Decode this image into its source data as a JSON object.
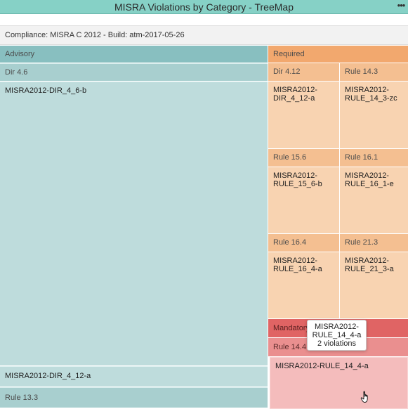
{
  "window": {
    "title": "MISRA Violations by Category - TreeMap",
    "menu_icon": "ellipsis-icon"
  },
  "subtitle": "Compliance: MISRA C 2012 - Build: atm-2017-05-26",
  "treemap": {
    "advisory": {
      "label": "Advisory",
      "dir_4_6": {
        "label": "Dir 4.6",
        "leaf": "MISRA2012-DIR_4_6-b"
      },
      "dir_4_12_leaf": "MISRA2012-DIR_4_12-a",
      "rule_13_3": "Rule 13.3"
    },
    "required": {
      "label": "Required",
      "dir_4_12": {
        "label": "Dir 4.12",
        "leaf": "MISRA2012-DIR_4_12-a"
      },
      "rule_14_3": {
        "label": "Rule 14.3",
        "leaf": "MISRA2012-RULE_14_3-zc"
      },
      "rule_15_6": {
        "label": "Rule 15.6",
        "leaf": "MISRA2012-RULE_15_6-b"
      },
      "rule_16_1": {
        "label": "Rule 16.1",
        "leaf": "MISRA2012-RULE_16_1-e"
      },
      "rule_16_4": {
        "label": "Rule 16.4",
        "leaf": "MISRA2012-RULE_16_4-a"
      },
      "rule_21_3": {
        "label": "Rule 21.3",
        "leaf": "MISRA2012-RULE_21_3-a"
      }
    },
    "mandatory": {
      "label": "Mandatory",
      "rule_14_4": {
        "label": "Rule 14.4",
        "leaf": "MISRA2012-RULE_14_4-a"
      }
    }
  },
  "tooltip": {
    "line1": "MISRA2012-",
    "line2": "RULE_14_4-a",
    "line3": "2 violations"
  },
  "colors": {
    "advisory": "#88bfc0",
    "required": "#f2a86e",
    "mandatory": "#e06464"
  }
}
